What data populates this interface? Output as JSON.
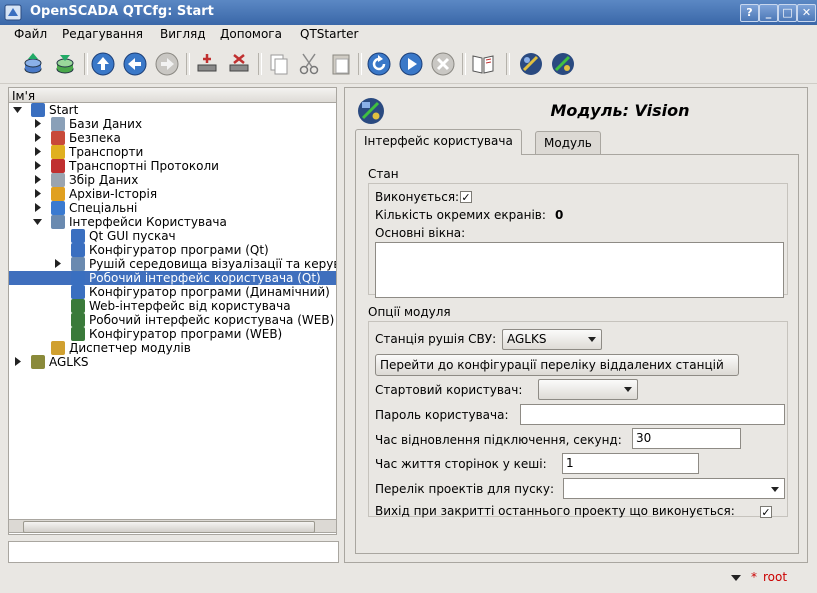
{
  "window": {
    "title": "OpenSCADA QTCfg: Start",
    "buttons": [
      "?",
      "_",
      "□",
      "✕"
    ]
  },
  "menu": [
    "Файл",
    "Редагування",
    "Вигляд",
    "Допомога",
    "QTStarter"
  ],
  "toolbar": {
    "icons": [
      "db-load-icon",
      "db-save-icon",
      "up-icon",
      "back-icon",
      "forward-icon",
      "add-icon",
      "delete-icon",
      "copy-icon",
      "cut-icon",
      "paste-icon",
      "refresh-icon",
      "start-icon",
      "stop-icon",
      "manual-icon",
      "qtcfg-icon",
      "vision-icon"
    ]
  },
  "tree": {
    "header": "Ім'я",
    "items": [
      {
        "label": "Start",
        "level": 0,
        "expanded": true,
        "icon_color": "#3a6fc0"
      },
      {
        "label": "Бази Даних",
        "level": 1,
        "expandable": true,
        "icon_color": "#8aa0b8"
      },
      {
        "label": "Безпека",
        "level": 1,
        "expandable": true,
        "icon_color": "#c84a3a"
      },
      {
        "label": "Транспорти",
        "level": 1,
        "expandable": true,
        "icon_color": "#e0b020"
      },
      {
        "label": "Транспортні Протоколи",
        "level": 1,
        "expandable": true,
        "icon_color": "#c03030"
      },
      {
        "label": "Збір Даних",
        "level": 1,
        "expandable": true,
        "icon_color": "#9aa4b0"
      },
      {
        "label": "Архіви-Історія",
        "level": 1,
        "expandable": true,
        "icon_color": "#e0a020"
      },
      {
        "label": "Спеціальні",
        "level": 1,
        "expandable": true,
        "icon_color": "#3a7ad0"
      },
      {
        "label": "Інтерфейси Користувача",
        "level": 1,
        "expanded": true,
        "icon_color": "#6a8ab0"
      },
      {
        "label": "Qt GUI пускач",
        "level": 2,
        "icon_color": "#3a6fc0"
      },
      {
        "label": "Конфігуратор програми (Qt)",
        "level": 2,
        "icon_color": "#3a6fc0"
      },
      {
        "label": "Рушій середовища візуалізації та керування",
        "level": 2,
        "expandable": true,
        "icon_color": "#6a8ab0"
      },
      {
        "label": "Робочий інтерфейс користувача (Qt)",
        "level": 2,
        "selected": true,
        "icon_color": "#3a6fc0"
      },
      {
        "label": "Конфігуратор програми (Динамічний)",
        "level": 2,
        "icon_color": "#3a6fc0"
      },
      {
        "label": "Web-інтерфейс від користувача",
        "level": 2,
        "icon_color": "#3a7a3a"
      },
      {
        "label": "Робочий інтерфейс користувача (WEB)",
        "level": 2,
        "icon_color": "#3a7a3a"
      },
      {
        "label": "Конфігуратор програми (WEB)",
        "level": 2,
        "icon_color": "#3a7a3a"
      },
      {
        "label": "Диспетчер модулів",
        "level": 1,
        "icon_color": "#d0a030"
      },
      {
        "label": "AGLKS",
        "level": 0,
        "expandable": true,
        "icon_color": "#8a8a3a"
      }
    ]
  },
  "module": {
    "title": "Модуль: Vision",
    "tabs": [
      "Інтерфейс користувача",
      "Модуль"
    ],
    "state": {
      "title": "Стан",
      "running_label": "Виконується:",
      "running": "✓",
      "screens_label": "Кількість окремих екранів:",
      "screens_value": "0",
      "main_windows_label": "Основні вікна:"
    },
    "options": {
      "title": "Опції модуля",
      "station_label": "Станція рушія СВУ:",
      "station_value": "AGLKS",
      "remote_button": "Перейти до конфігурації переліку віддалених станцій",
      "start_user_label": "Стартовий користувач:",
      "start_user_value": "",
      "password_label": "Пароль користувача:",
      "password_value": "",
      "restore_label": "Час відновлення підключення, секунд:",
      "restore_value": "30",
      "cache_label": "Час життя сторінок у кеші:",
      "cache_value": "1",
      "projects_label": "Перелік проектів для пуску:",
      "projects_value": "",
      "exit_label": "Вихід при закритті останнього проекту що виконується:",
      "exit_value": "✓"
    }
  },
  "status": {
    "star": "*",
    "user": "root"
  }
}
